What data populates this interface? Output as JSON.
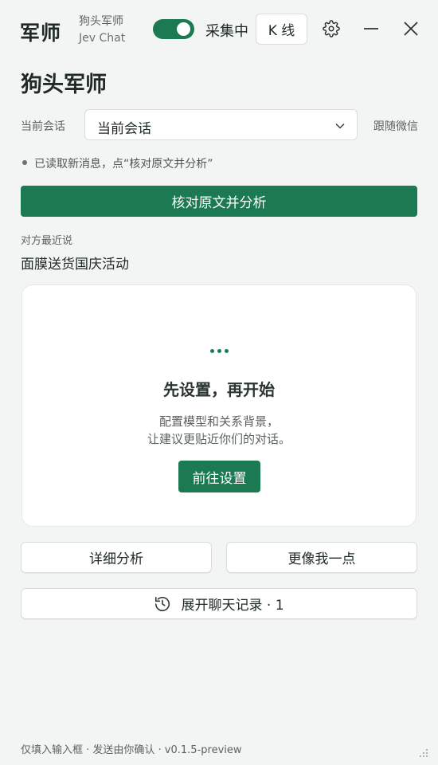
{
  "titlebar": {
    "logo": "军师",
    "app_name": "狗头军师",
    "app_sub": "Jev Chat",
    "collect_label": "采集中",
    "kline_label": "K 线"
  },
  "page": {
    "title": "狗头军师"
  },
  "session": {
    "label": "当前会话",
    "selected": "当前会话",
    "follow_label": "跟随微信"
  },
  "status": {
    "text": "已读取新消息，点“核对原文并分析”"
  },
  "actions": {
    "analyze_label": "核对原文并分析"
  },
  "last": {
    "label": "对方最近说",
    "message": "面膜送货国庆活动"
  },
  "card": {
    "title": "先设置，再开始",
    "desc_line1": "配置模型和关系背景，",
    "desc_line2": "让建议更贴近你们的对话。",
    "button": "前往设置"
  },
  "buttons": {
    "detail": "详细分析",
    "like_me": "更像我一点",
    "history": "展开聊天记录 · 1"
  },
  "footer": {
    "text": "仅填入输入框 · 发送由你确认 · v0.1.5-preview"
  },
  "colors": {
    "accent": "#1b7a52",
    "background": "#f3f5f4"
  },
  "icons": {
    "settings": "gear-icon",
    "minimize": "minimize-icon",
    "close": "close-icon",
    "dropdown": "chevron-down-icon",
    "history": "history-icon"
  }
}
